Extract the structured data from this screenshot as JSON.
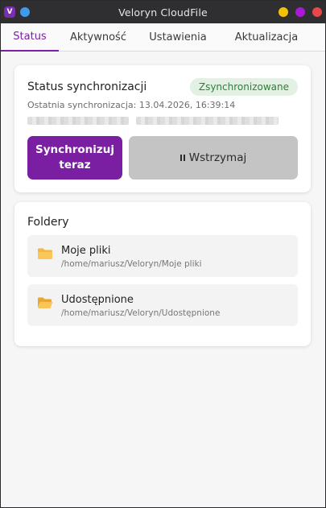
{
  "window": {
    "title": "Veloryn CloudFile",
    "app_icon_letter": "V",
    "accent": "#7b1fa2"
  },
  "tabs": [
    {
      "label": "Status",
      "active": true
    },
    {
      "label": "Aktywność",
      "active": false
    },
    {
      "label": "Ustawienia",
      "active": false
    },
    {
      "label": "Aktualizacja",
      "active": false
    }
  ],
  "status": {
    "title": "Status synchronizacji",
    "badge": "Zsynchronizowane",
    "badge_color": "#2f7d3a",
    "last_sync": "Ostatnia synchronizacja: 13.04.2026, 16:39:14",
    "sync_button": "Synchronizuj teraz",
    "pause_button": "Wstrzymaj"
  },
  "folders": {
    "title": "Foldery",
    "items": [
      {
        "name": "Moje pliki",
        "path": "/home/mariusz/Veloryn/Moje pliki",
        "icon": "folder-icon"
      },
      {
        "name": "Udostępnione",
        "path": "/home/mariusz/Veloryn/Udostępnione",
        "icon": "open-folder-icon"
      }
    ]
  }
}
